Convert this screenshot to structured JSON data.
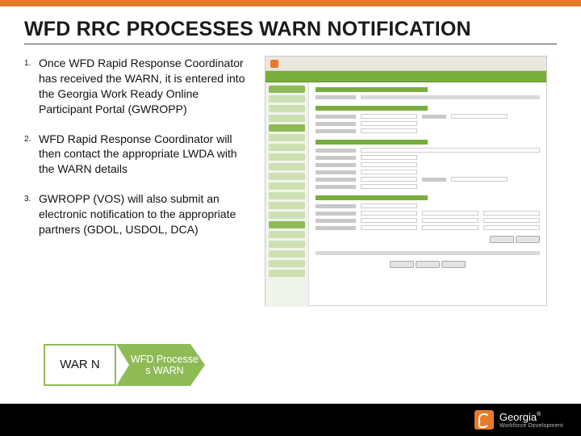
{
  "title": "WFD RRC PROCESSES WARN NOTIFICATION",
  "list": {
    "items": [
      {
        "num": "1.",
        "text": "Once WFD Rapid Response Coordinator has received the WARN, it is entered into the Georgia Work Ready Online Participant Portal (GWROPP)"
      },
      {
        "num": "2.",
        "text": "WFD Rapid Response Coordinator will then contact the appropriate LWDA with the WARN details"
      },
      {
        "num": "3.",
        "text": "GWROPP (VOS) will also submit an electronic notification to the appropriate partners (GDOL, USDOL, DCA)"
      }
    ]
  },
  "flow": {
    "box": "WAR N",
    "chevron": "WFD Processe s WARN"
  },
  "logo": {
    "name": "Georgia",
    "sub": "Workforce Development"
  }
}
